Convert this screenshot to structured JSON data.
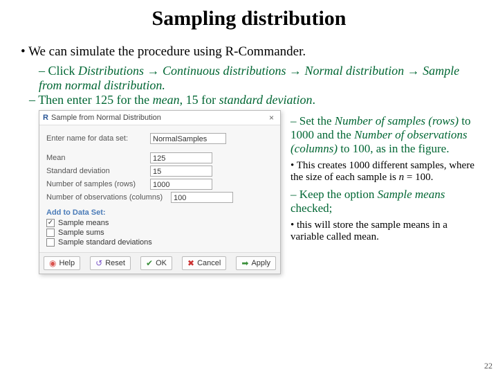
{
  "title": "Sampling distribution",
  "line1": "We can simulate the procedure using R-Commander.",
  "nav1a": "Click ",
  "nav1b": "Distributions → Continuous distributions → Normal distribution → Sample from normal distribution.",
  "line3a": "Then enter 125 for the ",
  "line3b": "mean",
  "line3c": ", 15 for ",
  "line3d": "standard deviation",
  "line3e": ".",
  "dialog": {
    "icon": "R",
    "title": "Sample from Normal Distribution",
    "close": "×",
    "nameLabel": "Enter name for data set:",
    "nameValue": "NormalSamples",
    "fields": [
      {
        "label": "Mean",
        "value": "125"
      },
      {
        "label": "Standard deviation",
        "value": "15"
      },
      {
        "label": "Number of samples (rows)",
        "value": "1000"
      },
      {
        "label": "Number of observations (columns)",
        "value": "100"
      }
    ],
    "section": "Add to Data Set:",
    "checks": [
      {
        "label": "Sample means",
        "checked": true
      },
      {
        "label": "Sample sums",
        "checked": false
      },
      {
        "label": "Sample standard deviations",
        "checked": false
      }
    ],
    "buttons": {
      "help": "Help",
      "reset": "Reset",
      "ok": "OK",
      "cancel": "Cancel",
      "apply": "Apply"
    }
  },
  "right": {
    "set1a": "Set the ",
    "set1b": "Number of samples (rows)",
    "set1c": " to 1000 and the ",
    "set1d": "Number of observations (columns)",
    "set1e": " to 100, as in the figure.",
    "creates1": "This creates 1000 different samples, where the size of each sample is ",
    "creates2": "n",
    "creates3": " = 100.",
    "keep1": "Keep the option ",
    "keep2": "Sample means",
    "keep3": " checked;",
    "store": "this will store the sample means in a variable called mean."
  },
  "pagenum": "22"
}
